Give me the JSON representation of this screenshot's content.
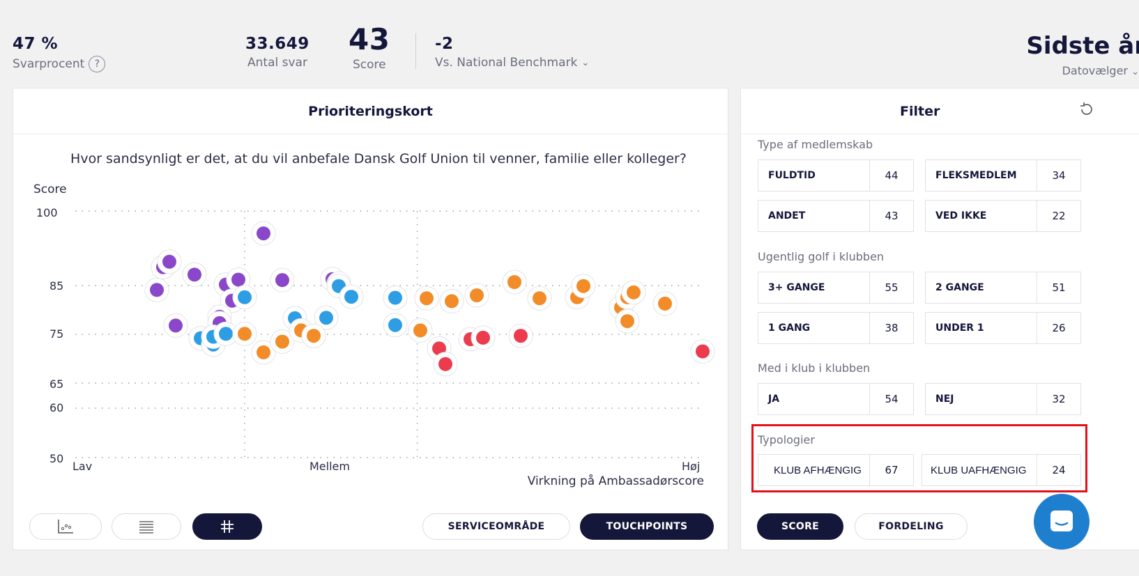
{
  "header": {
    "response_rate": {
      "value": "47 %",
      "label": "Svarprocent",
      "help": "?"
    },
    "answers": {
      "value": "33.649",
      "label": "Antal svar"
    },
    "score": {
      "value": "43",
      "label": "Score"
    },
    "benchmark": {
      "value": "-2",
      "label": "Vs. National Benchmark"
    },
    "period": {
      "value": "Sidste år",
      "label": "Datovælger"
    }
  },
  "chart_panel": {
    "title": "Prioriteringskort",
    "buttons": {
      "service": "SERVICEOMRÅDE",
      "touchpoints": "TOUCHPOINTS"
    },
    "view_icons": [
      "scatter-view-icon",
      "list-view-icon",
      "grid-view-icon"
    ]
  },
  "chart_data": {
    "type": "scatter",
    "title": "Hvor sandsynligt er det, at du vil anbefale Dansk Golf Union til venner, familie eller kolleger?",
    "ylabel": "Score",
    "xlabel": "Virkning på Ambassadørscore",
    "ylim": [
      50,
      100
    ],
    "yticks": [
      "100",
      "85",
      "75",
      "65",
      "60",
      "50"
    ],
    "x_categories": [
      "Lav",
      "Mellem",
      "Høj"
    ],
    "grid": "dotted",
    "colors": {
      "purple": "#8a47c9",
      "blue": "#2d9ee4",
      "orange": "#f28c28",
      "red": "#eb3b4d"
    },
    "series": [
      {
        "color": "purple",
        "points": [
          [
            0.13,
            84.1
          ],
          [
            0.16,
            76.8
          ],
          [
            0.14,
            88.7
          ],
          [
            0.15,
            89.8
          ],
          [
            0.19,
            87.2
          ],
          [
            0.24,
            85.2
          ],
          [
            0.26,
            86.2
          ],
          [
            0.25,
            81.9
          ],
          [
            0.23,
            78.6
          ],
          [
            0.3,
            95.5
          ],
          [
            0.33,
            86.1
          ],
          [
            0.41,
            86.3
          ],
          [
            0.42,
            85.4
          ],
          [
            0.23,
            77.3
          ]
        ]
      },
      {
        "color": "blue",
        "points": [
          [
            0.2,
            74.2
          ],
          [
            0.22,
            72.9
          ],
          [
            0.22,
            74.5
          ],
          [
            0.24,
            75.1
          ],
          [
            0.27,
            82.6
          ],
          [
            0.35,
            78.3
          ],
          [
            0.4,
            78.4
          ],
          [
            0.42,
            84.9
          ],
          [
            0.44,
            82.7
          ],
          [
            0.51,
            82.5
          ],
          [
            0.51,
            76.9
          ]
        ]
      },
      {
        "color": "orange",
        "points": [
          [
            0.27,
            75.1
          ],
          [
            0.3,
            71.3
          ],
          [
            0.33,
            73.5
          ],
          [
            0.36,
            75.8
          ],
          [
            0.38,
            74.7
          ],
          [
            0.55,
            75.8
          ],
          [
            0.56,
            82.4
          ],
          [
            0.6,
            81.8
          ],
          [
            0.64,
            83.0
          ],
          [
            0.7,
            85.7
          ],
          [
            0.74,
            82.4
          ],
          [
            0.8,
            82.6
          ],
          [
            0.81,
            84.9
          ],
          [
            0.87,
            80.5
          ],
          [
            0.88,
            82.6
          ],
          [
            0.89,
            83.6
          ],
          [
            0.88,
            77.7
          ],
          [
            0.94,
            81.3
          ]
        ]
      },
      {
        "color": "red",
        "points": [
          [
            0.58,
            72.1
          ],
          [
            0.59,
            68.9
          ],
          [
            0.63,
            74.0
          ],
          [
            0.65,
            74.3
          ],
          [
            0.71,
            74.7
          ],
          [
            1.0,
            71.5
          ]
        ]
      }
    ]
  },
  "filter": {
    "title": "Filter",
    "groups": [
      {
        "title": "Type af medlemskab",
        "items": [
          [
            "FULDTID",
            "44"
          ],
          [
            "FLEKSMEDLEM",
            "34"
          ],
          [
            "ANDET",
            "43"
          ],
          [
            "VED IKKE",
            "22"
          ]
        ]
      },
      {
        "title": "Ugentlig golf i klubben",
        "items": [
          [
            "3+ GANGE",
            "55"
          ],
          [
            "2 GANGE",
            "51"
          ],
          [
            "1 GANG",
            "38"
          ],
          [
            "UNDER 1",
            "26"
          ]
        ]
      },
      {
        "title": "Med i klub i klubben",
        "items": [
          [
            "JA",
            "54"
          ],
          [
            "NEJ",
            "32"
          ]
        ]
      },
      {
        "title": "Typologier",
        "items": [
          [
            "KLUB AFHÆNGIG",
            "67"
          ],
          [
            "KLUB UAFHÆNGIG",
            "24"
          ]
        ]
      }
    ],
    "buttons": {
      "score": "SCORE",
      "distribution": "FORDELING"
    }
  }
}
